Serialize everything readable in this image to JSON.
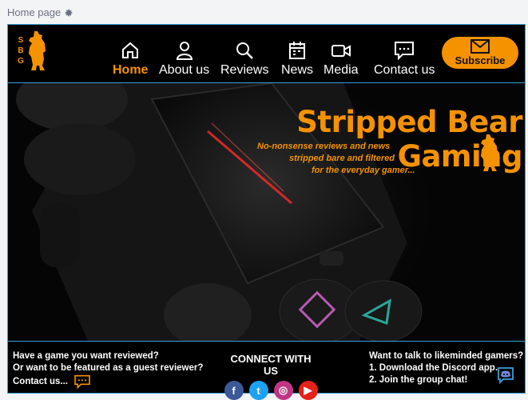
{
  "topbar": {
    "label": "Home page",
    "settings_icon": "gear-icon"
  },
  "logo": {
    "letters": [
      "S",
      "B",
      "G"
    ]
  },
  "nav": {
    "items": [
      {
        "label": "Home",
        "icon": "home-icon",
        "active": true
      },
      {
        "label": "About us",
        "icon": "person-icon",
        "active": false
      },
      {
        "label": "Reviews",
        "icon": "magnifier-icon",
        "active": false
      },
      {
        "label": "News",
        "icon": "calendar-icon",
        "active": false
      },
      {
        "label": "Media",
        "icon": "video-camera-icon",
        "active": false
      },
      {
        "label": "Contact us",
        "icon": "chat-bubble-icon",
        "active": false
      }
    ],
    "subscribe": {
      "label": "Subscribe",
      "icon": "envelope-icon"
    }
  },
  "hero": {
    "title": "Stripped Bear Gaming",
    "tagline": [
      "No-nonsense reviews and news",
      "stripped bare and filtered",
      "for the everyday gamer..."
    ]
  },
  "footer": {
    "left": [
      "Have a game you want reviewed?",
      "Or want to be featured as a guest reviewer?",
      "Contact us..."
    ],
    "connect_title": "CONNECT WITH US",
    "socials": [
      {
        "name": "facebook",
        "glyph": "f",
        "color": "#3b5998"
      },
      {
        "name": "twitter",
        "glyph": "t",
        "color": "#1da1f2"
      },
      {
        "name": "instagram",
        "glyph": "◎",
        "color": "#c13584"
      },
      {
        "name": "youtube",
        "glyph": "▶",
        "color": "#e62117"
      }
    ],
    "right": [
      "Want to talk to likeminded gamers?",
      "1. Download the Discord app.",
      "2. Join the group chat!"
    ]
  },
  "colors": {
    "accent": "#f59200",
    "frame_border": "#3aa0d8",
    "background": "#000000"
  }
}
